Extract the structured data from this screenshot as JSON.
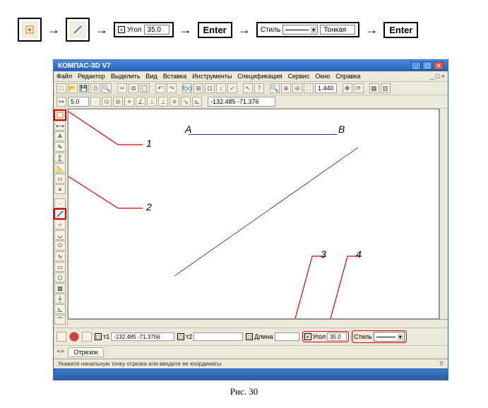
{
  "flow": {
    "angle_label": "Угол",
    "angle_value": "35.0",
    "enter1": "Enter",
    "style_label": "Стиль",
    "style_value": "Тонкая",
    "enter2": "Enter"
  },
  "app": {
    "title": "КОМПАС-3D V7",
    "menu": [
      "Файл",
      "Редактор",
      "Выделить",
      "Вид",
      "Вставка",
      "Инструменты",
      "Спецификация",
      "Сервис",
      "Окно",
      "Справка"
    ],
    "toolbar2": {
      "field1": "5.0",
      "coords": "-132.485  -71.376",
      "zoom": "1.440"
    },
    "canvas": {
      "A": "A",
      "B": "B",
      "labels": {
        "n1": "1",
        "n2": "2",
        "n3": "3",
        "n4": "4"
      }
    },
    "bottom": {
      "t1_label": "т1",
      "t1_val": "-132.485  -71.3756",
      "t2_label": "т2",
      "dlina_label": "Длина",
      "ugol_label": "Угол",
      "ugol_val": "35.0",
      "stil_label": "Стиль"
    },
    "tab": "Отрезок",
    "status": "Укажите начальную точку отрезка или введите ее координаты"
  },
  "caption": "Рис. 30"
}
